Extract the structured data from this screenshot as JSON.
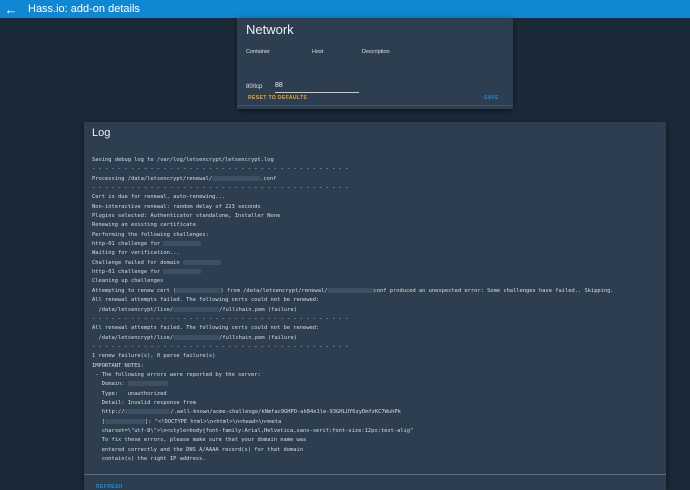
{
  "header": {
    "title": "Hass.io: add-on details",
    "back_icon": "arrow-left-icon"
  },
  "network": {
    "title": "Network",
    "columns": {
      "container": "Container",
      "host": "Host",
      "description": "Description"
    },
    "container_value": "80/tcp",
    "host_value": "88",
    "reset_label": "RESET TO DEFAULTS",
    "save_label": "SAVE"
  },
  "log": {
    "title": "Log",
    "refresh_label": "REFRESH",
    "lines": [
      {
        "text": "Saving debug log to /var/log/letsencrypt/letsencrypt.log"
      },
      {
        "text": "- - - - - - - - - - - - - - - - - - - - - - - - - - - - - - - - - - - - - - - -"
      },
      {
        "text": "Processing /data/letsencrypt/renewal/",
        "redact": 48,
        "tail": ".conf"
      },
      {
        "text": "- - - - - - - - - - - - - - - - - - - - - - - - - - - - - - - - - - - - - - - -"
      },
      {
        "text": "Cert is due for renewal, auto-renewing..."
      },
      {
        "text": "Non-interactive renewal: random delay of 223 seconds"
      },
      {
        "text": "Plugins selected: Authenticator standalone, Installer None"
      },
      {
        "text": "Renewing an existing certificate"
      },
      {
        "text": "Performing the following challenges:"
      },
      {
        "text": "http-01 challenge for ",
        "redact": 38
      },
      {
        "text": "Waiting for verification..."
      },
      {
        "text": "Challenge failed for domain ",
        "redact": 38
      },
      {
        "text": "http-01 challenge for ",
        "redact": 38
      },
      {
        "text": "Cleaning up challenges"
      },
      {
        "text": "Attempting to renew cert (",
        "redact": 44,
        "tail": ") from /data/letsencrypt/renewal/",
        "redact2": 46,
        "tail2": "conf produced an unexpected error: Some challenges have failed.. Skipping."
      },
      {
        "text": "All renewal attempts failed. The following certs could not be renewed:"
      },
      {
        "text": "  /data/letsencrypt/live/",
        "redact": 46,
        "tail": "/fullchain.pem (failure)"
      },
      {
        "text": "- - - - - - - - - - - - - - - - - - - - - - - - - - - - - - - - - - - - - - - -"
      },
      {
        "text": "All renewal attempts failed. The following certs could not be renewed:"
      },
      {
        "text": "  /data/letsencrypt/live/",
        "redact": 46,
        "tail": "/fullchain.pem (failure)"
      },
      {
        "text": "- - - - - - - - - - - - - - - - - - - - - - - - - - - - - - - - - - - - - - - -"
      },
      {
        "text": "1 renew failure(s), 0 parse failure(s)"
      },
      {
        "text": "IMPORTANT NOTES:"
      },
      {
        "text": " - The following errors were reported by the server:"
      },
      {
        "text": "   Domain: ",
        "redact": 40
      },
      {
        "text": "   Type:   unauthorized"
      },
      {
        "text": "   Detail: Invalid response from"
      },
      {
        "text": "   http://",
        "redact": 46,
        "tail": "/.well-known/acme-challenge/kNmfac9GHPO-ah84e1le-93GHLUY6zyDmfzKC7WuhPk"
      },
      {
        "text": "   [",
        "redact": 40,
        "tail": "]: \"<!DOCTYPE html>\\n<html>\\n<head>\\n<meta"
      },
      {
        "text": "   charset=\\\"utf-8\\\">\\n<style>body{font-family:Arial,Helvetica,sans-serif;font-size:12px;text-alig\""
      },
      {
        "text": "   To fix these errors, please make sure that your domain name was"
      },
      {
        "text": "   entered correctly and the DNS A/AAAA record(s) for that domain"
      },
      {
        "text": "   contain(s) the right IP address."
      }
    ]
  }
}
